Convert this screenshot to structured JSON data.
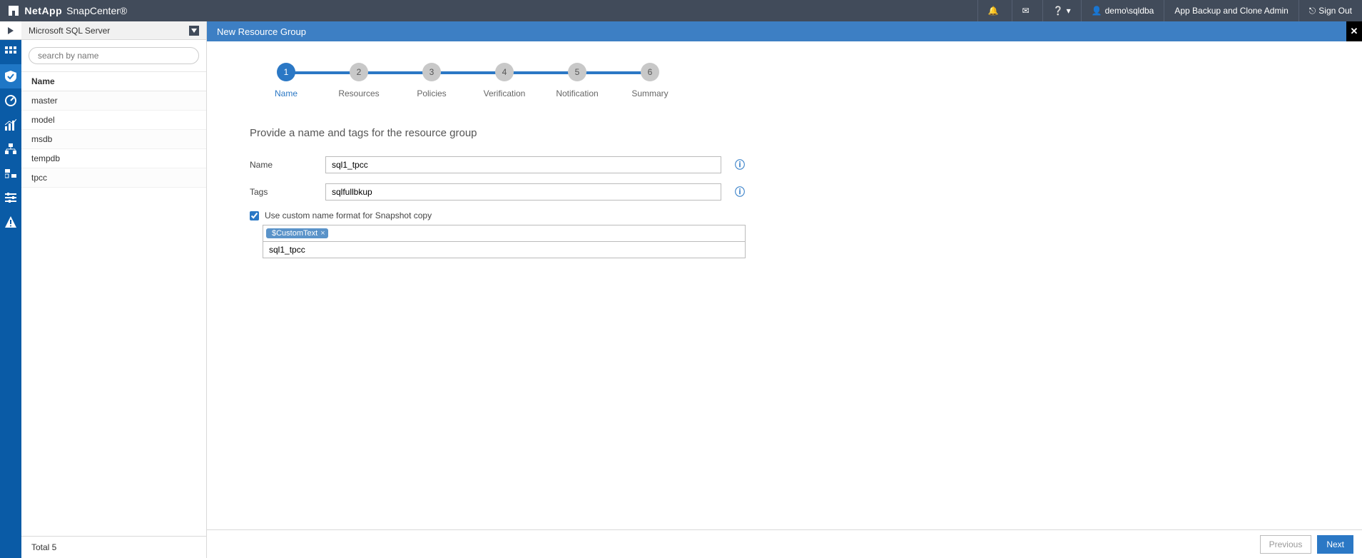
{
  "brand": {
    "vendor": "NetApp",
    "product": "SnapCenter®"
  },
  "topbar": {
    "user": "demo\\sqldba",
    "role": "App Backup and Clone Admin",
    "signout": "Sign Out"
  },
  "leftpanel": {
    "context": "Microsoft SQL Server",
    "search_placeholder": "search by name",
    "column_header": "Name",
    "rows": [
      "master",
      "model",
      "msdb",
      "tempdb",
      "tpcc"
    ],
    "footer": "Total 5"
  },
  "main": {
    "banner": "New Resource Group",
    "steps": [
      {
        "num": "1",
        "label": "Name",
        "active": true
      },
      {
        "num": "2",
        "label": "Resources",
        "active": false
      },
      {
        "num": "3",
        "label": "Policies",
        "active": false
      },
      {
        "num": "4",
        "label": "Verification",
        "active": false
      },
      {
        "num": "5",
        "label": "Notification",
        "active": false
      },
      {
        "num": "6",
        "label": "Summary",
        "active": false
      }
    ],
    "form": {
      "heading": "Provide a name and tags for the resource group",
      "name_label": "Name",
      "name_value": "sql1_tpcc",
      "tags_label": "Tags",
      "tags_value": "sqlfullbkup",
      "chk_label": "Use custom name format for Snapshot copy",
      "chk_checked": true,
      "chip": "$CustomText",
      "sub_value": "sql1_tpcc"
    },
    "buttons": {
      "prev": "Previous",
      "next": "Next"
    }
  }
}
